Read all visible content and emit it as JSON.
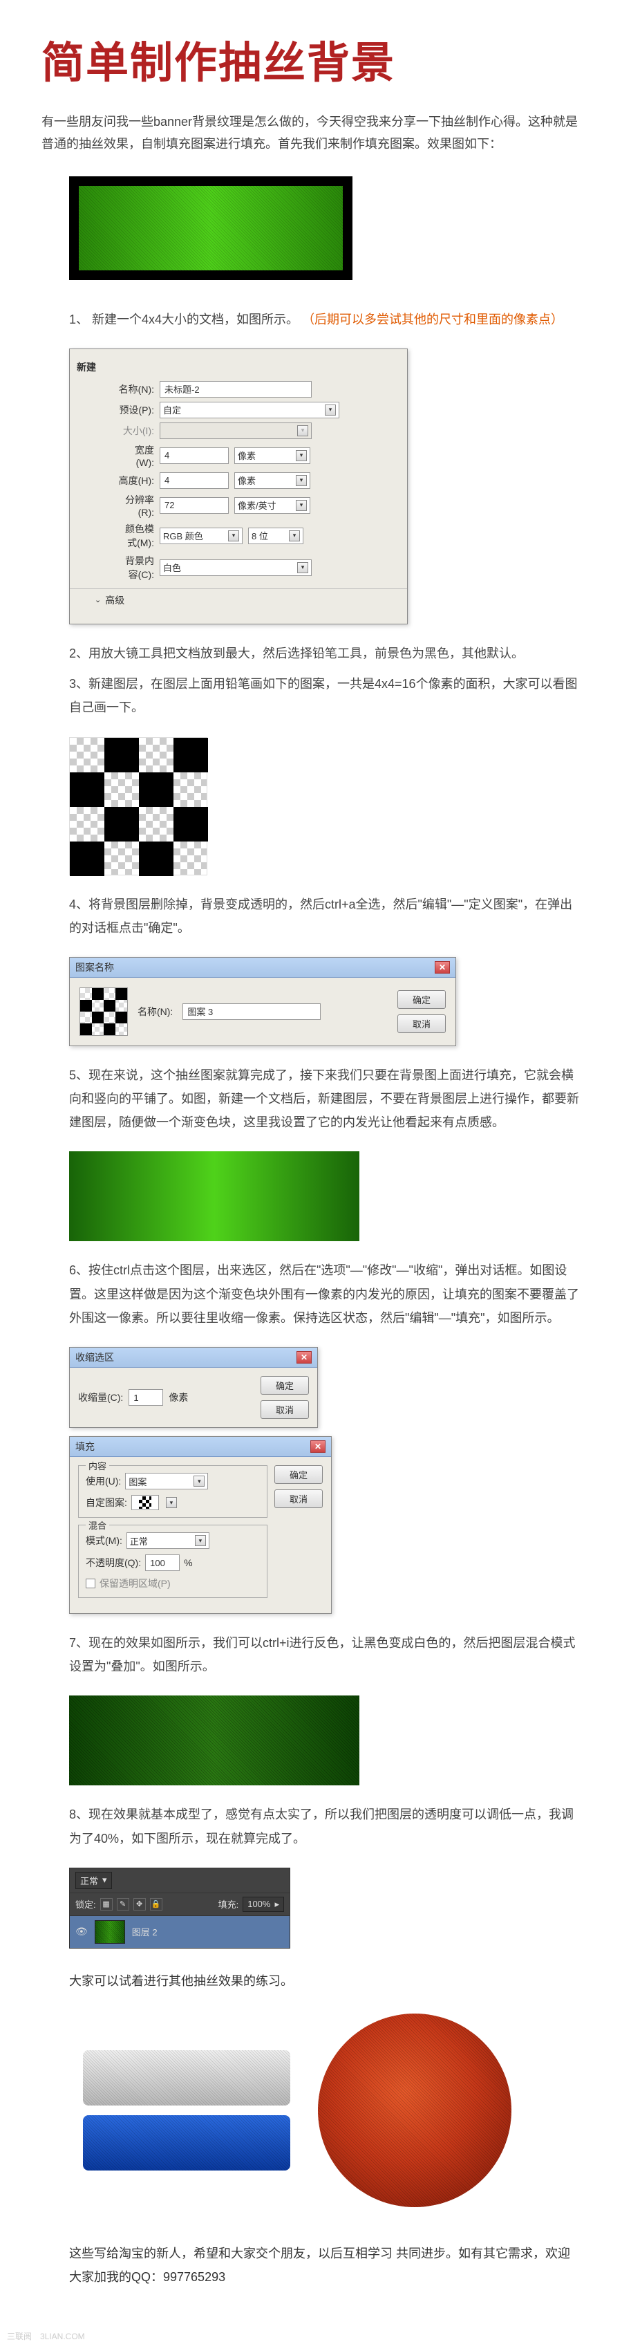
{
  "title": "简单制作抽丝背景",
  "intro": "有一些朋友问我一些banner背景纹理是怎么做的，今天得空我来分享一下抽丝制作心得。这种就是普通的抽丝效果，自制填充图案进行填充。首先我们来制作填充图案。效果图如下：",
  "step1": "1、 新建一个4x4大小的文档，如图所示。",
  "step1_note": "（后期可以多尝试其他的尺寸和里面的像素点）",
  "new_dialog": {
    "title": "新建",
    "name_label": "名称(N):",
    "name_value": "未标题-2",
    "preset_label": "预设(P):",
    "preset_value": "自定",
    "size_label": "大小(I):",
    "width_label": "宽度(W):",
    "width_value": "4",
    "width_unit": "像素",
    "height_label": "高度(H):",
    "height_value": "4",
    "height_unit": "像素",
    "res_label": "分辨率(R):",
    "res_value": "72",
    "res_unit": "像素/英寸",
    "mode_label": "颜色模式(M):",
    "mode_value": "RGB 颜色",
    "mode_bits": "8 位",
    "bg_label": "背景内容(C):",
    "bg_value": "白色",
    "advanced": "高级"
  },
  "step2": "2、用放大镜工具把文档放到最大，然后选择铅笔工具，前景色为黑色，其他默认。",
  "step3": "3、新建图层，在图层上面用铅笔画如下的图案，一共是4x4=16个像素的面积，大家可以看图自己画一下。",
  "step4": "4、将背景图层删除掉，背景变成透明的，然后ctrl+a全选，然后\"编辑\"—\"定义图案\"，在弹出的对话框点击\"确定\"。",
  "pattern_dialog": {
    "title": "图案名称",
    "name_label": "名称(N):",
    "name_value": "图案 3",
    "ok": "确定",
    "cancel": "取消"
  },
  "step5": "5、现在来说，这个抽丝图案就算完成了，接下来我们只要在背景图上面进行填充，它就会横向和竖向的平铺了。如图，新建一个文档后，新建图层，不要在背景图层上进行操作，都要新建图层，随便做一个渐变色块，这里我设置了它的内发光让他看起来有点质感。",
  "step6": "6、按住ctrl点击这个图层，出来选区，然后在\"选项\"—\"修改\"—\"收缩\"，弹出对话框。如图设置。这里这样做是因为这个渐变色块外围有一像素的内发光的原因，让填充的图案不要覆盖了外围这一像素。所以要往里收缩一像素。保持选区状态，然后\"编辑\"—\"填充\"，如图所示。",
  "shrink_dialog": {
    "title": "收缩选区",
    "amount_label": "收缩量(C):",
    "amount_value": "1",
    "amount_unit": "像素",
    "ok": "确定",
    "cancel": "取消"
  },
  "fill_dialog": {
    "title": "填充",
    "content_section": "内容",
    "use_label": "使用(U):",
    "use_value": "图案",
    "custom_label": "自定图案:",
    "blend_section": "混合",
    "mode_label": "模式(M):",
    "mode_value": "正常",
    "opacity_label": "不透明度(Q):",
    "opacity_value": "100",
    "opacity_unit": "%",
    "preserve_label": "保留透明区域(P)",
    "ok": "确定",
    "cancel": "取消"
  },
  "step7": "7、现在的效果如图所示，我们可以ctrl+i进行反色，让黑色变成白色的，然后把图层混合模式设置为\"叠加\"。如图所示。",
  "step8": "8、现在效果就基本成型了，感觉有点太实了，所以我们把图层的透明度可以调低一点，我调为了40%，如下图所示，现在就算完成了。",
  "layers": {
    "mode": "正常",
    "lock_label": "锁定:",
    "fill_label": "填充:",
    "fill_value": "100%",
    "layer_name": "图层 2"
  },
  "conclude": "大家可以试着进行其他抽丝效果的练习。",
  "footer": "这些写给淘宝的新人，希望和大家交个朋友，以后互相学习 共同进步。如有其它需求，欢迎大家加我的QQ：997765293",
  "watermark": "三联阅　3LIAN.COM"
}
